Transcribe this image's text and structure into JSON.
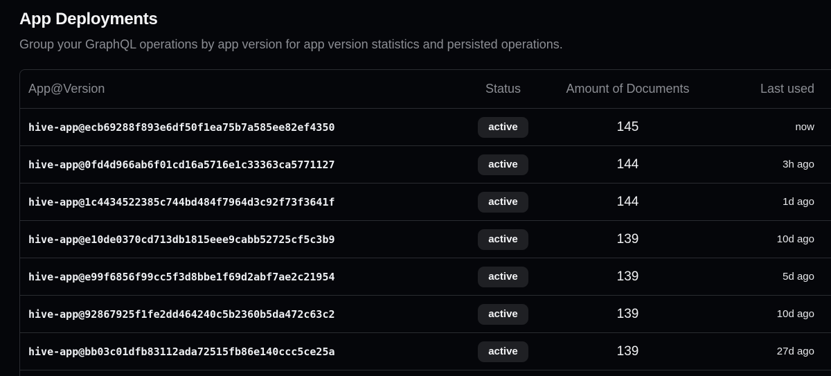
{
  "header": {
    "title": "App Deployments",
    "subtitle": "Group your GraphQL operations by app version for app version statistics and persisted operations."
  },
  "table": {
    "columns": {
      "app": "App@Version",
      "status": "Status",
      "documents": "Amount of Documents",
      "last_used": "Last used"
    },
    "rows": [
      {
        "app": "hive-app@ecb69288f893e6df50f1ea75b7a585ee82ef4350",
        "status": "active",
        "documents": "145",
        "last_used": "now"
      },
      {
        "app": "hive-app@0fd4d966ab6f01cd16a5716e1c33363ca5771127",
        "status": "active",
        "documents": "144",
        "last_used": "3h ago"
      },
      {
        "app": "hive-app@1c4434522385c744bd484f7964d3c92f73f3641f",
        "status": "active",
        "documents": "144",
        "last_used": "1d ago"
      },
      {
        "app": "hive-app@e10de0370cd713db1815eee9cabb52725cf5c3b9",
        "status": "active",
        "documents": "139",
        "last_used": "10d ago"
      },
      {
        "app": "hive-app@e99f6856f99cc5f3d8bbe1f69d2abf7ae2c21954",
        "status": "active",
        "documents": "139",
        "last_used": "5d ago"
      },
      {
        "app": "hive-app@92867925f1fe2dd464240c5b2360b5da472c63c2",
        "status": "active",
        "documents": "139",
        "last_used": "10d ago"
      },
      {
        "app": "hive-app@bb03c01dfb83112ada72515fb86e140ccc5ce25a",
        "status": "active",
        "documents": "139",
        "last_used": "27d ago"
      }
    ]
  }
}
